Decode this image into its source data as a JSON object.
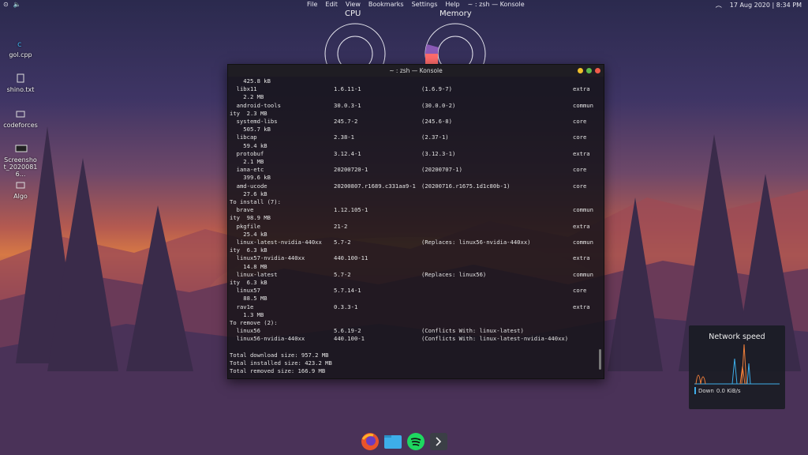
{
  "topbar": {
    "menu": [
      "File",
      "Edit",
      "View",
      "Bookmarks",
      "Settings",
      "Help"
    ],
    "window_title": "~ : zsh — Konsole",
    "datetime": "17 Aug 2020 | 8:34 PM"
  },
  "desktop_icons": [
    {
      "label": "gol.cpp",
      "icon": "cpp-file-icon"
    },
    {
      "label": "shino.txt",
      "icon": "text-file-icon"
    },
    {
      "label": "codeforces",
      "icon": "folder-icon"
    },
    {
      "label": "Screenshot_20200816...",
      "icon": "image-file-icon"
    },
    {
      "label": "Algo",
      "icon": "folder-icon"
    }
  ],
  "gauges": {
    "cpu_label": "CPU",
    "memory_label": "Memory"
  },
  "konsole": {
    "title": "~ : zsh — Konsole",
    "lines": [
      [
        "    425.8 kB",
        "",
        "",
        ""
      ],
      [
        "  libx11",
        "1.6.11-1",
        "(1.6.9-7)",
        "extra"
      ],
      [
        "    2.2 MB",
        "",
        "",
        ""
      ],
      [
        "  android-tools",
        "30.0.3-1",
        "(30.0.0-2)",
        "commun"
      ],
      [
        "ity  2.3 MB",
        "",
        "",
        ""
      ],
      [
        "  systemd-libs",
        "245.7-2",
        "(245.6-8)",
        "core"
      ],
      [
        "    505.7 kB",
        "",
        "",
        ""
      ],
      [
        "  libcap",
        "2.38-1",
        "(2.37-1)",
        "core"
      ],
      [
        "    59.4 kB",
        "",
        "",
        ""
      ],
      [
        "  protobuf",
        "3.12.4-1",
        "(3.12.3-1)",
        "extra"
      ],
      [
        "    2.1 MB",
        "",
        "",
        ""
      ],
      [
        "  iana-etc",
        "20200720-1",
        "(20200707-1)",
        "core"
      ],
      [
        "    399.6 kB",
        "",
        "",
        ""
      ],
      [
        "  amd-ucode",
        "20200807.r1689.c331aa9-1",
        "(20200716.r1675.1d1c80b-1)",
        "core"
      ],
      [
        "    27.6 kB",
        "",
        "",
        ""
      ],
      [
        "To install (7):",
        "",
        "",
        ""
      ],
      [
        "  brave",
        "1.12.105-1",
        "",
        "commun"
      ],
      [
        "ity  98.9 MB",
        "",
        "",
        ""
      ],
      [
        "  pkgfile",
        "21-2",
        "",
        "extra"
      ],
      [
        "    25.4 kB",
        "",
        "",
        ""
      ],
      [
        "  linux-latest-nvidia-440xx",
        "5.7-2",
        "(Replaces: linux56-nvidia-440xx)",
        "commun"
      ],
      [
        "ity  6.3 kB",
        "",
        "",
        ""
      ],
      [
        "  linux57-nvidia-440xx",
        "440.100-11",
        "",
        "extra"
      ],
      [
        "    14.8 MB",
        "",
        "",
        ""
      ],
      [
        "  linux-latest",
        "5.7-2",
        "(Replaces: linux56)",
        "commun"
      ],
      [
        "ity  6.3 kB",
        "",
        "",
        ""
      ],
      [
        "  linux57",
        "5.7.14-1",
        "",
        "core"
      ],
      [
        "    88.5 MB",
        "",
        "",
        ""
      ],
      [
        "  rav1e",
        "0.3.3-1",
        "",
        "extra"
      ],
      [
        "    1.3 MB",
        "",
        "",
        ""
      ],
      [
        "To remove (2):",
        "",
        "",
        ""
      ],
      [
        "  linux56",
        "5.6.19-2",
        "(Conflicts With: linux-latest)",
        ""
      ],
      [
        "  linux56-nvidia-440xx",
        "440.100-1",
        "(Conflicts With: linux-latest-nvidia-440xx)",
        ""
      ],
      [
        "",
        "",
        "",
        ""
      ],
      [
        "Total download size: 957.2 MB",
        "",
        "",
        ""
      ],
      [
        "Total installed size: 423.2 MB",
        "",
        "",
        ""
      ],
      [
        "Total removed size: 166.9 MB",
        "",
        "",
        ""
      ]
    ]
  },
  "network_widget": {
    "title": "Network speed",
    "download_label": "Down",
    "download_value": "0.0 KiB/s"
  },
  "dock": [
    {
      "name": "firefox",
      "icon": "firefox-icon"
    },
    {
      "name": "files",
      "icon": "folder-icon"
    },
    {
      "name": "spotify",
      "icon": "spotify-icon"
    },
    {
      "name": "konsole",
      "icon": "terminal-icon"
    }
  ],
  "colors": {
    "accent": "#3daee9",
    "close": "#ef5b4a",
    "minimize": "#f0c02a",
    "maximize": "#5dbb4c",
    "memory_used": "#ff6b6b",
    "memory_purple": "#8a5ab5",
    "net_orange": "#f07f3a",
    "net_blue": "#3daee9"
  }
}
